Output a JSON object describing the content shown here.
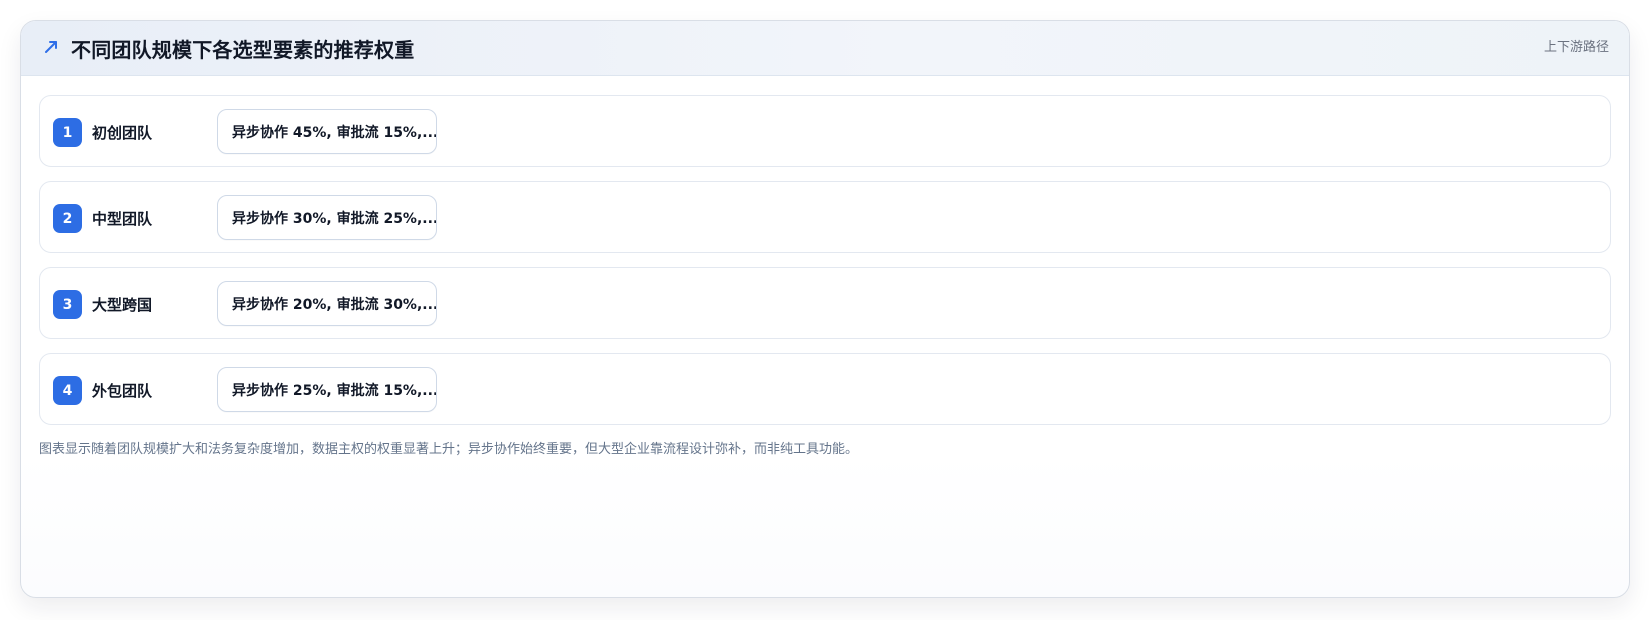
{
  "header": {
    "icon": "trend-arrow-icon",
    "title": "不同团队规模下各选型要素的推荐权重",
    "right_link": "上下游路径"
  },
  "rows": [
    {
      "index": "1",
      "label": "初创团队",
      "chip": "异步协作 45%, 审批流 15%,..."
    },
    {
      "index": "2",
      "label": "中型团队",
      "chip": "异步协作 30%, 审批流 25%,..."
    },
    {
      "index": "3",
      "label": "大型跨国",
      "chip": "异步协作 20%, 审批流 30%,..."
    },
    {
      "index": "4",
      "label": "外包团队",
      "chip": "异步协作 25%, 审批流 15%,..."
    }
  ],
  "footnote": "图表显示随着团队规模扩大和法务复杂度增加，数据主权的权重显著上升；异步协作始终重要，但大型企业靠流程设计弥补，而非纯工具功能。",
  "colors": {
    "accent": "#2d6de4",
    "title_text": "#111827",
    "muted_text": "#64748b",
    "border": "#e3e8f0"
  }
}
